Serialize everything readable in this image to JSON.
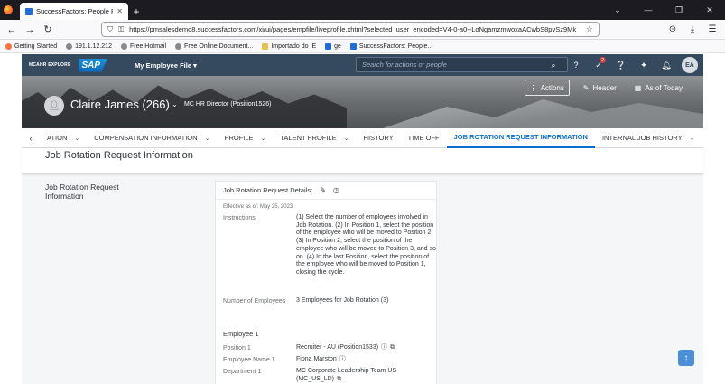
{
  "browser": {
    "tab_title": "SuccessFactors: People Profile",
    "url": "https://pmsalesdemo8.successfactors.com/xi/ui/pages/empfile/liveprofile.xhtml?selected_user_encoded=V4-0-a0--LoNgamzmwoxaACwbS8pvSz9Mk",
    "bookmarks": [
      "Getting Started",
      "191.1.12.212",
      "Free Hotmail",
      "Free Online Document...",
      "Importado do IE",
      "ge",
      "SuccessFactors: People..."
    ]
  },
  "shell": {
    "brand": "MCAHR EXPLORE",
    "logo": "SAP",
    "menu_title": "My Employee File",
    "search_placeholder": "Search for actions or people",
    "notification_count": "2",
    "user_initials": "EA"
  },
  "header": {
    "employee_name": "Claire James (266)",
    "position": "MC HR Director (Position1526)",
    "actions_label": "Actions",
    "header_label": "Header",
    "as_of_label": "As of Today"
  },
  "tabs": [
    "ATION",
    "COMPENSATION INFORMATION",
    "PROFILE",
    "TALENT PROFILE",
    "HISTORY",
    "TIME OFF",
    "JOB ROTATION REQUEST INFORMATION",
    "INTERNAL JOB HISTORY"
  ],
  "section": {
    "title": "Job Rotation Request Information",
    "side_label": "Job Rotation Request Information",
    "card_title": "Job Rotation Request Details:",
    "effective": "Effective as of: May 25, 2023",
    "instructions_label": "Instructions",
    "instructions_text": "(1) Select the number of employees involved in Job Rotation. (2) In Position 1, select the position of the employee who will be moved to Position 2. (3) In Position 2, select the position of the employee who will be moved to Position 3, and so on. (4) In the last Position, select the position of the employee who will be moved to Position 1, closing the cycle.",
    "num_employees_label": "Number of Employees",
    "num_employees_value": "3 Employees for Job Rotation (3)",
    "employee_head": "Employee 1",
    "position_label": "Position 1",
    "position_value": "Recruiter - AU (Position1533)",
    "employee_name_label": "Employee Name 1",
    "employee_name_value": "Fiona Marston",
    "department_label": "Department 1",
    "department_value": "MC Corporate Leadership Team US (MC_US_LD)"
  }
}
